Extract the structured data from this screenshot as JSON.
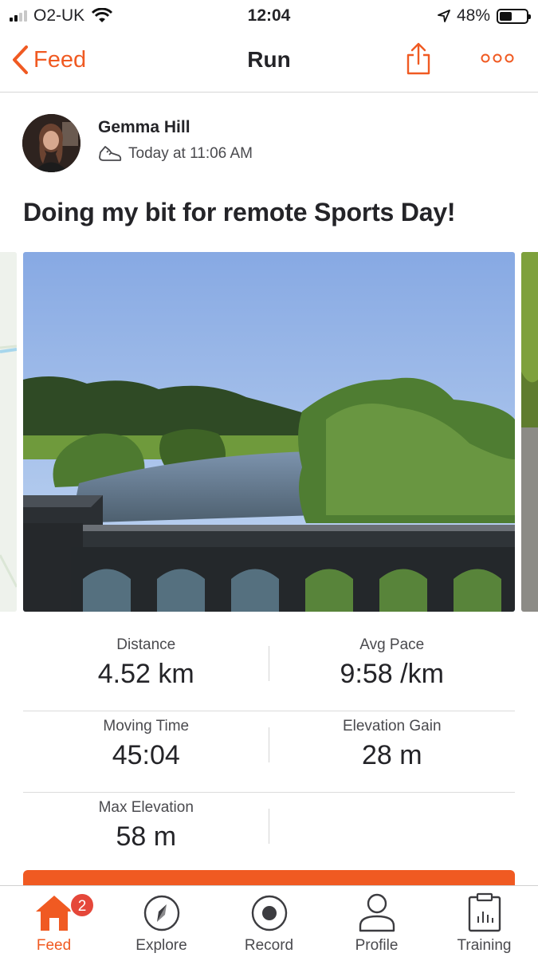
{
  "status_bar": {
    "carrier": "O2-UK",
    "time": "12:04",
    "battery": "48%",
    "battery_level": 0.48,
    "icons": [
      "signal-icon",
      "wifi-icon",
      "location-arrow-icon",
      "battery-icon"
    ]
  },
  "nav": {
    "back_label": "Feed",
    "title": "Run",
    "actions": [
      "share-icon",
      "more-icon"
    ]
  },
  "post": {
    "author_name": "Gemma Hill",
    "activity_icon": "shoe-icon",
    "timestamp": "Today at 11:06 AM",
    "title": "Doing my bit for remote Sports Day!"
  },
  "stats": [
    {
      "label": "Distance",
      "value": "4.52 km"
    },
    {
      "label": "Avg Pace",
      "value": "9:58 /km"
    },
    {
      "label": "Moving Time",
      "value": "45:04"
    },
    {
      "label": "Elevation Gain",
      "value": "28 m"
    },
    {
      "label": "Max Elevation",
      "value": "58 m"
    }
  ],
  "tab_bar": {
    "tabs": [
      {
        "label": "Feed",
        "icon": "home-icon",
        "badge": "2"
      },
      {
        "label": "Explore",
        "icon": "compass-icon"
      },
      {
        "label": "Record",
        "icon": "record-icon"
      },
      {
        "label": "Profile",
        "icon": "profile-icon"
      },
      {
        "label": "Training",
        "icon": "clipboard-icon"
      }
    ]
  },
  "colors": {
    "accent": "#f05a22",
    "text": "#242428",
    "badge": "#e5473a"
  }
}
